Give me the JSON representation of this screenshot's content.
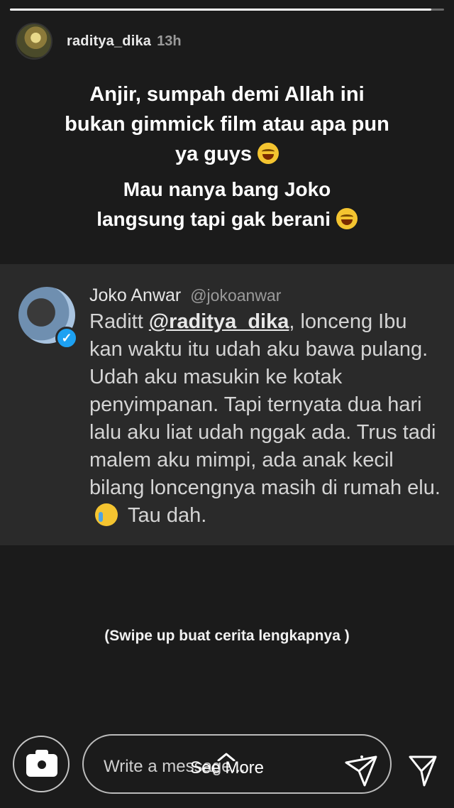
{
  "story": {
    "progress": 0.97,
    "username": "raditya_dika",
    "time_ago": "13h"
  },
  "captions": {
    "line1": "Anjir, sumpah demi Allah ini bukan gimmick film atau apa pun ya guys",
    "line2": "Mau nanya bang Joko langsung tapi gak berani"
  },
  "tweet": {
    "name": "Joko Anwar",
    "handle": "@jokoanwar",
    "text_prefix": "Raditt",
    "mention": "@raditya_dika",
    "text_main": ", lonceng Ibu kan waktu itu udah aku bawa pulang. Udah aku masukin ke kotak penyimpanan. Tapi ternyata dua hari lalu aku liat udah nggak ada. Trus tadi malem aku mimpi, ada anak kecil bilang loncengnya masih di rumah elu.",
    "text_suffix": "Tau dah."
  },
  "swipe_text": "(Swipe up buat cerita lengkapnya )",
  "bottom_bar": {
    "message_placeholder": "Write a message...",
    "see_more_label": "See More"
  }
}
